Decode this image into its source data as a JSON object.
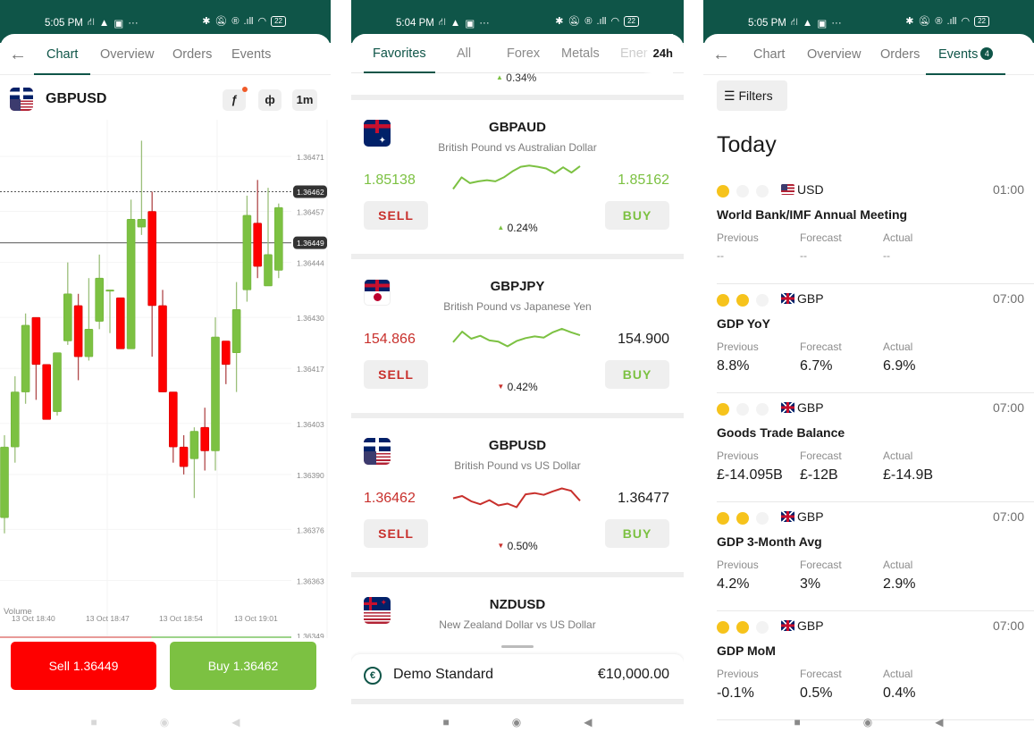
{
  "screen1": {
    "status": {
      "time": "5:05 PM",
      "icons_left": [
        "network-icon",
        "warning-icon",
        "image-icon",
        "more-dots"
      ],
      "icons_right": [
        "bluetooth-icon",
        "mute-icon",
        "registered-icon",
        "signal-icon",
        "wifi-icon"
      ],
      "battery": "22"
    },
    "tabs": [
      {
        "label": "Chart",
        "active": true
      },
      {
        "label": "Overview"
      },
      {
        "label": "Orders"
      },
      {
        "label": "Events"
      }
    ],
    "symbol": "GBPUSD",
    "toolbar": {
      "indicator_label": "ƒ",
      "chart_type_label": "ф",
      "timeframe_label": "1m"
    },
    "volume_label": "Volume",
    "sell_button": "Sell 1.36449",
    "buy_button": "Buy 1.36462",
    "colors": {
      "up": "#7cc142",
      "down": "#fe0000",
      "brand": "#0f5548"
    }
  },
  "chart_data": {
    "type": "candlestick",
    "title": "GBPUSD 1m",
    "ylim": [
      1.36345,
      1.36488
    ],
    "y_ticks": [
      "1.36471",
      "1.36457",
      "1.36444",
      "1.36430",
      "1.36417",
      "1.36403",
      "1.36390",
      "1.36376",
      "1.36363",
      "1.36349"
    ],
    "x_ticks": [
      "13 Oct 18:40",
      "13 Oct 18:47",
      "13 Oct 18:54",
      "13 Oct 19:01"
    ],
    "ask_line": {
      "label": "1.36462",
      "value": 1.36462
    },
    "bid_line": {
      "label": "1.36449",
      "value": 1.36449
    },
    "volume_split": {
      "sell_fraction": 0.52,
      "buy_fraction": 0.48
    },
    "candles": [
      {
        "o": 1.36379,
        "h": 1.364,
        "l": 1.36375,
        "c": 1.36397
      },
      {
        "o": 1.36397,
        "h": 1.36415,
        "l": 1.36393,
        "c": 1.36411
      },
      {
        "o": 1.36411,
        "h": 1.36431,
        "l": 1.36408,
        "c": 1.36428
      },
      {
        "o": 1.3643,
        "h": 1.3643,
        "l": 1.36409,
        "c": 1.36418
      },
      {
        "o": 1.36418,
        "h": 1.36418,
        "l": 1.36405,
        "c": 1.36404
      },
      {
        "o": 1.36406,
        "h": 1.36421,
        "l": 1.36405,
        "c": 1.36421
      },
      {
        "o": 1.36424,
        "h": 1.36444,
        "l": 1.36423,
        "c": 1.36436
      },
      {
        "o": 1.36433,
        "h": 1.36436,
        "l": 1.36414,
        "c": 1.3642
      },
      {
        "o": 1.3642,
        "h": 1.3644,
        "l": 1.36419,
        "c": 1.36427
      },
      {
        "o": 1.36429,
        "h": 1.36446,
        "l": 1.36427,
        "c": 1.3644
      },
      {
        "o": 1.36437,
        "h": 1.36437,
        "l": 1.36426,
        "c": 1.36437
      },
      {
        "o": 1.36435,
        "h": 1.36435,
        "l": 1.36424,
        "c": 1.36422
      },
      {
        "o": 1.36422,
        "h": 1.3646,
        "l": 1.36422,
        "c": 1.36455
      },
      {
        "o": 1.36453,
        "h": 1.36475,
        "l": 1.36451,
        "c": 1.36455
      },
      {
        "o": 1.36457,
        "h": 1.36462,
        "l": 1.3642,
        "c": 1.36433
      },
      {
        "o": 1.36433,
        "h": 1.36437,
        "l": 1.36411,
        "c": 1.36411
      },
      {
        "o": 1.36411,
        "h": 1.36411,
        "l": 1.36393,
        "c": 1.36397
      },
      {
        "o": 1.36397,
        "h": 1.364,
        "l": 1.3639,
        "c": 1.36392
      },
      {
        "o": 1.36394,
        "h": 1.36402,
        "l": 1.36384,
        "c": 1.36401
      },
      {
        "o": 1.36402,
        "h": 1.36407,
        "l": 1.36391,
        "c": 1.36396
      },
      {
        "o": 1.36396,
        "h": 1.3643,
        "l": 1.36391,
        "c": 1.36425
      },
      {
        "o": 1.36424,
        "h": 1.36424,
        "l": 1.36413,
        "c": 1.36418
      },
      {
        "o": 1.36421,
        "h": 1.36439,
        "l": 1.36411,
        "c": 1.36432
      },
      {
        "o": 1.36437,
        "h": 1.36461,
        "l": 1.36434,
        "c": 1.36456
      },
      {
        "o": 1.36454,
        "h": 1.36465,
        "l": 1.3644,
        "c": 1.36443
      },
      {
        "o": 1.36438,
        "h": 1.36463,
        "l": 1.36438,
        "c": 1.36446
      },
      {
        "o": 1.36442,
        "h": 1.36459,
        "l": 1.3644,
        "c": 1.36458
      }
    ]
  },
  "screen2": {
    "status": {
      "time": "5:04 PM",
      "battery": "22"
    },
    "tabs": [
      {
        "label": "Favorites",
        "active": true
      },
      {
        "label": "All"
      },
      {
        "label": "Forex"
      },
      {
        "label": "Metals"
      },
      {
        "label": "Ener"
      }
    ],
    "period": "24h",
    "partial_change": "0.34%",
    "instruments": [
      {
        "symbol": "GBPAUD",
        "description": "British Pound vs Australian Dollar",
        "flag": "uk-au",
        "bid": "1.85138",
        "ask": "1.85162",
        "bid_color": "#7cc142",
        "ask_color": "#7cc142",
        "trend": "up",
        "change": "0.24%",
        "spark_color": "#7cc142",
        "spark": [
          2,
          6,
          4,
          4.6,
          5,
          4.6,
          6,
          8,
          9.6,
          10,
          9.6,
          9,
          7.4,
          9.4,
          7.6,
          9.8
        ]
      },
      {
        "symbol": "GBPJPY",
        "description": "British Pound vs Japanese Yen",
        "flag": "uk-jp",
        "bid": "154.866",
        "ask": "154.900",
        "bid_color": "#c8302c",
        "ask_color": "#1a1a1a",
        "trend": "down",
        "change": "0.42%",
        "spark_color": "#7cc142",
        "spark": [
          4,
          7.6,
          5.2,
          6.2,
          4.6,
          4.2,
          2.6,
          4.4,
          5.4,
          6,
          5.6,
          7.4,
          8.6,
          7.4,
          6.4
        ]
      },
      {
        "symbol": "GBPUSD",
        "description": "British Pound vs US Dollar",
        "flag": "us-uk",
        "bid": "1.36462",
        "ask": "1.36477",
        "bid_color": "#c8302c",
        "ask_color": "#1a1a1a",
        "trend": "down",
        "change": "0.50%",
        "spark_color": "#c8302c",
        "spark": [
          5,
          5.8,
          4,
          3,
          4.4,
          2.6,
          3.2,
          2,
          6.4,
          6.8,
          6.2,
          7.4,
          8.4,
          7.6,
          4.2
        ]
      },
      {
        "symbol": "NZDUSD",
        "description": "New Zealand Dollar vs US Dollar",
        "flag": "nz-us"
      }
    ],
    "account": {
      "name": "Demo Standard",
      "balance": "€10,000.00",
      "currency_symbol": "€"
    }
  },
  "screen3": {
    "status": {
      "time": "5:05 PM",
      "battery": "22"
    },
    "tabs": [
      {
        "label": "Chart"
      },
      {
        "label": "Overview"
      },
      {
        "label": "Orders"
      },
      {
        "label": "Events",
        "active": true,
        "badge": "4"
      }
    ],
    "filters_label": "Filters",
    "section_title": "Today",
    "labels": {
      "previous": "Previous",
      "forecast": "Forecast",
      "actual": "Actual"
    },
    "events": [
      {
        "importance": 1,
        "currency": "USD",
        "flag": "us",
        "time": "01:00",
        "name": "World Bank/IMF Annual Meeting",
        "previous": "--",
        "forecast": "--",
        "actual": "--"
      },
      {
        "importance": 2,
        "currency": "GBP",
        "flag": "uk",
        "time": "07:00",
        "name": "GDP YoY",
        "previous": "8.8%",
        "forecast": "6.7%",
        "actual": "6.9%"
      },
      {
        "importance": 1,
        "currency": "GBP",
        "flag": "uk",
        "time": "07:00",
        "name": "Goods Trade Balance",
        "previous": "£-14.095B",
        "forecast": "£-12B",
        "actual": "£-14.9B"
      },
      {
        "importance": 2,
        "currency": "GBP",
        "flag": "uk",
        "time": "07:00",
        "name": "GDP 3-Month Avg",
        "previous": "4.2%",
        "forecast": "3%",
        "actual": "2.9%"
      },
      {
        "importance": 2,
        "currency": "GBP",
        "flag": "uk",
        "time": "07:00",
        "name": "GDP MoM",
        "previous": "-0.1%",
        "forecast": "0.5%",
        "actual": "0.4%"
      }
    ]
  }
}
